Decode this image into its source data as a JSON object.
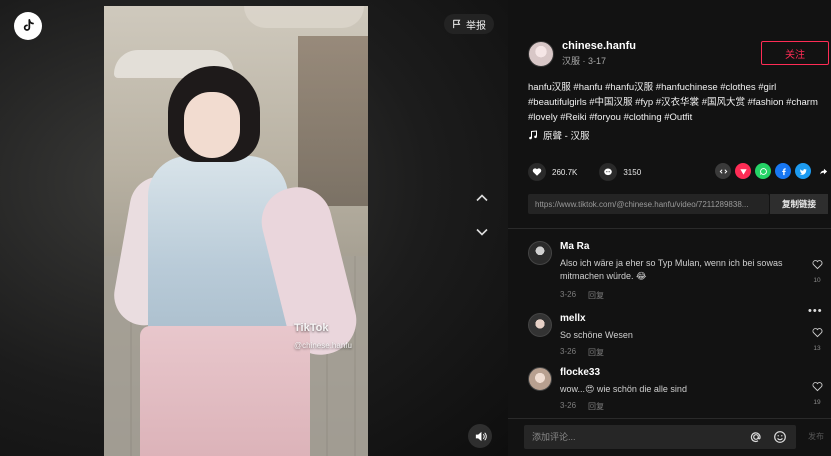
{
  "video": {
    "report_label": "举报",
    "watermark_brand": "TikTok",
    "watermark_handle": "@chinese.hanfu"
  },
  "author": {
    "name": "chinese.hanfu",
    "subtitle": "汉服 · 3-17",
    "follow_label": "关注"
  },
  "post": {
    "caption": "hanfu汉服 #hanfu #hanfu汉服 #hanfuchinese #clothes #girl #beautifulgirls #中国汉服 #fyp #汉衣华裳 #国风大赏 #fashion #charm #lovely #Reiki #foryou #clothing #Outfit",
    "music": "原聲 - 汉服",
    "likes": "260.7K",
    "comments_count": "3150",
    "link": "https://www.tiktok.com/@chinese.hanfu/video/7211289838...",
    "copy_label": "复制链接"
  },
  "comments": [
    {
      "user": "Ma Ra",
      "text": "Also ich wäre ja eher so Typ Mulan, wenn ich bei sowas mitmachen würde. 😂",
      "date": "3-26",
      "reply": "回复",
      "likes": "10"
    },
    {
      "user": "mellx",
      "text": "So schöne Wesen",
      "date": "3-26",
      "reply": "回复",
      "likes": "13"
    },
    {
      "user": "flocke33",
      "text": "wow...😍 wie schön die alle sind",
      "date": "3-26",
      "reply": "回复",
      "likes": "19"
    }
  ],
  "comment_bar": {
    "placeholder": "添加评论...",
    "post_label": "发布"
  },
  "colors": {
    "accent": "#fe2c55",
    "background": "#121212"
  },
  "icons": {
    "logo": "tiktok-logo-icon",
    "report": "flag-icon",
    "up": "chevron-up-icon",
    "down": "chevron-down-icon",
    "volume": "volume-icon",
    "like": "heart-icon",
    "comment": "comment-icon",
    "music": "music-note-icon",
    "mention": "at-icon",
    "emoji": "emoji-icon"
  }
}
